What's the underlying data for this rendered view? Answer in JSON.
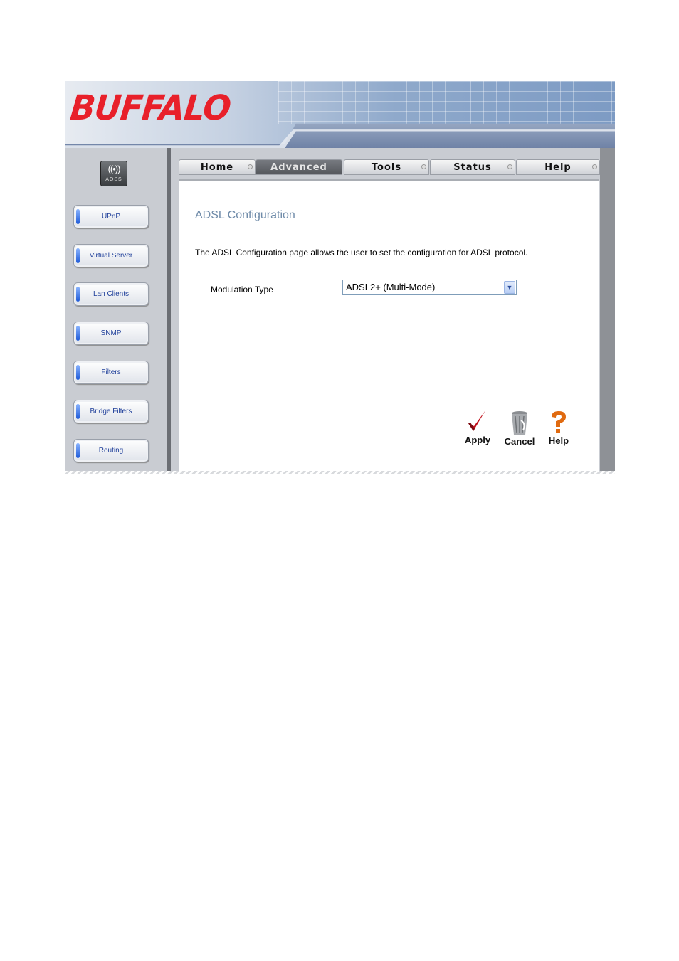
{
  "brand": {
    "logo_text": "BUFFALO",
    "logo_color": "#e8202a"
  },
  "aoss": {
    "label": "AOSS"
  },
  "sidebar": {
    "items": [
      {
        "label": "UPnP"
      },
      {
        "label": "Virtual Server"
      },
      {
        "label": "Lan Clients"
      },
      {
        "label": "SNMP"
      },
      {
        "label": "Filters"
      },
      {
        "label": "Bridge Filters"
      },
      {
        "label": "Routing"
      }
    ]
  },
  "tabs": [
    {
      "label": "Home",
      "active": false
    },
    {
      "label": "Advanced",
      "active": true
    },
    {
      "label": "Tools",
      "active": false
    },
    {
      "label": "Status",
      "active": false
    },
    {
      "label": "Help",
      "active": false
    }
  ],
  "main": {
    "title": "ADSL Configuration",
    "description": "The ADSL Configuration page allows the user to set the configuration for ADSL protocol.",
    "modulation": {
      "label": "Modulation Type",
      "selected": "ADSL2+ (Multi-Mode)"
    }
  },
  "actions": {
    "apply_label": "Apply",
    "cancel_label": "Cancel",
    "help_label": "Help"
  },
  "colors": {
    "title": "#6f8ba9",
    "accent_red": "#c0101a",
    "help_orange": "#e06a10"
  }
}
